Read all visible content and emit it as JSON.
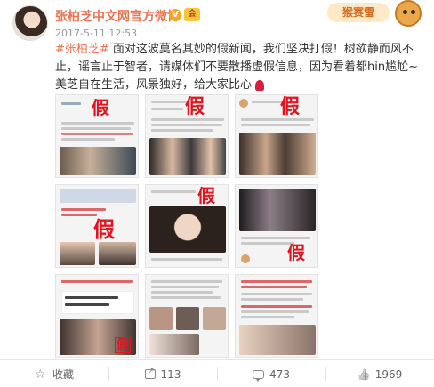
{
  "header": {
    "username": "张柏芝中文网官方微博",
    "verified_icon": "verified-v-icon",
    "member_icon": "weibo-member-icon",
    "timestamp": "2017-5-11 12:53",
    "event_badge": "猴赛雷"
  },
  "post": {
    "topic": "#张柏芝#",
    "body": " 面对这波莫名其妙的假新闻，我们坚决打假！树欲静而风不止，谣言止于智者，请媒体们不要散播虚假信息，因为看着都hin尴尬~美芝自在生活，风景独好，给大家比心",
    "emoji_icon": "rose-icon"
  },
  "images": {
    "fake_stamp": "假",
    "caption_false": "假"
  },
  "actions": {
    "favorite_label": "收藏",
    "share_count": "113",
    "comment_count": "473",
    "like_count": "1969"
  },
  "colors": {
    "accent": "#eb7350",
    "stamp": "#e0161c"
  }
}
